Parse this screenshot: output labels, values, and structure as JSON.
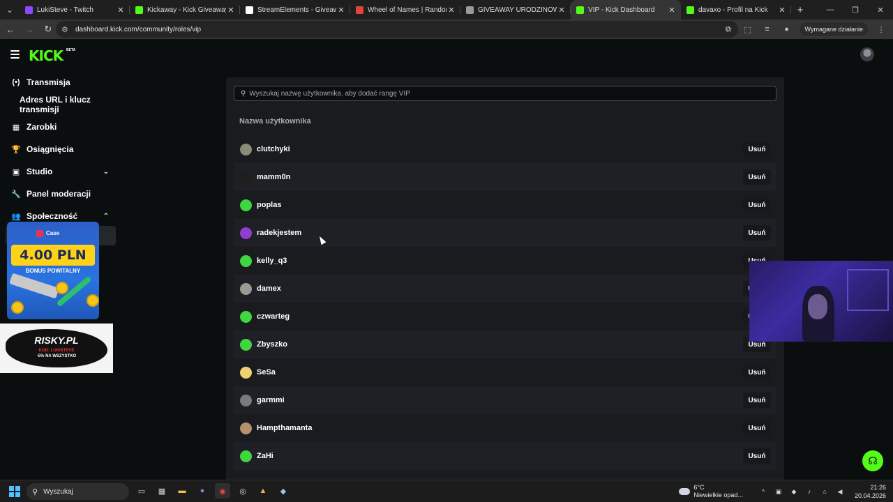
{
  "browser": {
    "tabs": [
      {
        "title": "LukiSteve - Twitch",
        "color": "#9146ff",
        "active": false
      },
      {
        "title": "Kickaway - Kick Giveaway Tool",
        "color": "#53fc18",
        "active": false
      },
      {
        "title": "StreamElements - Giveaways",
        "color": "#ffffff",
        "active": false
      },
      {
        "title": "Wheel of Names | Random nam",
        "color": "#e0463a",
        "active": false
      },
      {
        "title": "GIVEAWAY URODZINOWY",
        "color": "#9a9a9a",
        "active": false
      },
      {
        "title": "VIP - Kick Dashboard",
        "color": "#53fc18",
        "active": true
      },
      {
        "title": "davaxo - Profil na Kick",
        "color": "#53fc18",
        "active": false
      }
    ],
    "url": "dashboard.kick.com/community/roles/vip",
    "required_action": "Wymagane działanie"
  },
  "sidebar": {
    "logo": "KICK",
    "logo_badge": "BETA",
    "items": [
      {
        "label": "Transmisja",
        "icon": "broadcast-icon",
        "glyph": "(•)"
      },
      {
        "label": "Adres URL i klucz transmisji",
        "icon": "",
        "glyph": ""
      },
      {
        "label": "Zarobki",
        "icon": "earnings-icon",
        "glyph": "▦"
      },
      {
        "label": "Osiągnięcia",
        "icon": "trophy-icon",
        "glyph": "🏆"
      },
      {
        "label": "Studio",
        "icon": "studio-icon",
        "glyph": "▣"
      },
      {
        "label": "Panel moderacji",
        "icon": "wrench-icon",
        "glyph": "🔧"
      },
      {
        "label": "Społeczność",
        "icon": "community-icon",
        "glyph": "👥"
      }
    ]
  },
  "ads": {
    "case_brand": "Case",
    "case_amount": "4.00 PLN",
    "case_bonus": "BONUS POWITALNY",
    "risky_title": "RISKY.PL",
    "risky_code": "KOD: LUKISTEVE",
    "risky_discount": "-5% NA WSZYSTKO"
  },
  "vip": {
    "search_placeholder": "Wyszukaj nazwę użytkownika, aby dodać rangę VIP",
    "column_header": "Nazwa użytkownika",
    "remove_label": "Usuń",
    "users": [
      {
        "name": "clutchyki",
        "avatar_color": "#8a8c78"
      },
      {
        "name": "mamm0n",
        "avatar_color": "#1e1e1e"
      },
      {
        "name": "poplas",
        "avatar_color": "#3fd63f"
      },
      {
        "name": "radekjestem",
        "avatar_color": "#8e3fd0"
      },
      {
        "name": "kelly_q3",
        "avatar_color": "#3fd63f"
      },
      {
        "name": "damex",
        "avatar_color": "#9a9a90"
      },
      {
        "name": "czwarteg",
        "avatar_color": "#3fd63f"
      },
      {
        "name": "Zbyszko",
        "avatar_color": "#3fd63f"
      },
      {
        "name": "SeSa",
        "avatar_color": "#f0d070"
      },
      {
        "name": "garmmi",
        "avatar_color": "#7a7a7a"
      },
      {
        "name": "Hampthamanta",
        "avatar_color": "#b89070"
      },
      {
        "name": "ZaHi",
        "avatar_color": "#3fd63f"
      }
    ]
  },
  "taskbar": {
    "search_label": "Wyszukaj",
    "weather_temp": "6°C",
    "weather_desc": "Niewielkie opad...",
    "time": "21:26",
    "date": "20.04.2026"
  }
}
